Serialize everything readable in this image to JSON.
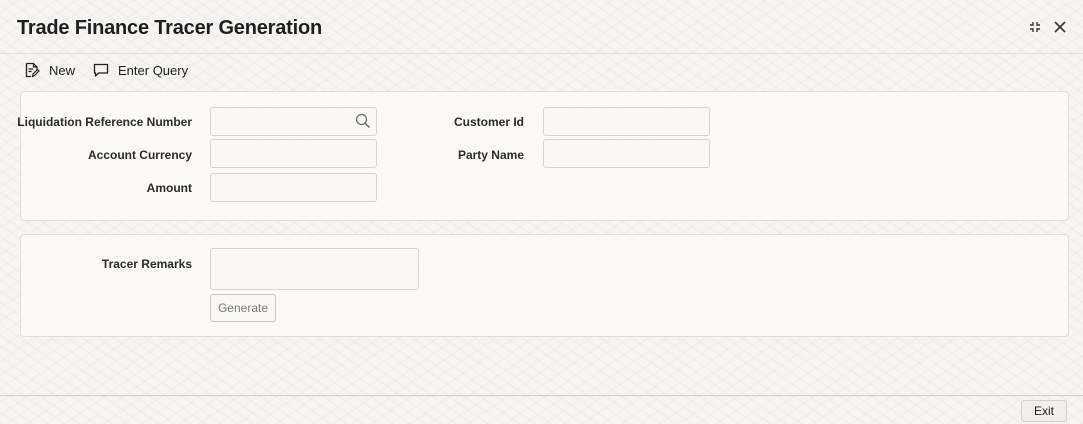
{
  "window": {
    "title": "Trade Finance Tracer Generation",
    "expand_icon": "expand-icon",
    "close_icon": "close-icon"
  },
  "toolbar": {
    "new_label": "New",
    "new_icon": "new-document-icon",
    "enter_query_label": "Enter Query",
    "enter_query_icon": "query-icon"
  },
  "form": {
    "liquidation_reference_number": {
      "label": "Liquidation Reference Number",
      "value": "",
      "icon": "search-icon"
    },
    "account_currency": {
      "label": "Account Currency",
      "value": ""
    },
    "amount": {
      "label": "Amount",
      "value": ""
    },
    "customer_id": {
      "label": "Customer Id",
      "value": ""
    },
    "party_name": {
      "label": "Party Name",
      "value": ""
    }
  },
  "tracer": {
    "remarks_label": "Tracer Remarks",
    "remarks_value": "",
    "generate_label": "Generate"
  },
  "footer": {
    "exit_label": "Exit"
  },
  "colors": {
    "background": "#f6f5f3",
    "panel": "#fbfaf8",
    "border": "#d8d5d1",
    "text": "#1f1f1f",
    "disabled_text": "#7a7a7a"
  }
}
